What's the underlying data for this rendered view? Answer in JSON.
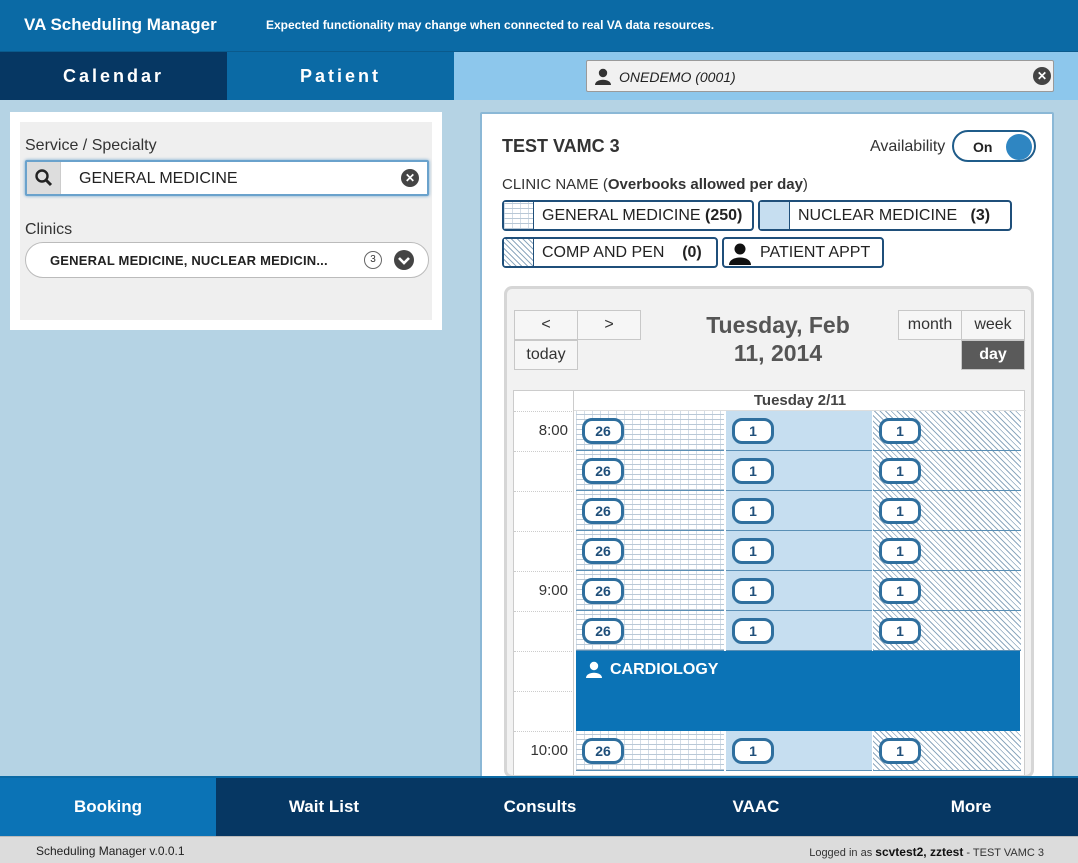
{
  "header": {
    "app_title": "VA Scheduling Manager",
    "notice": "Expected functionality may change when connected to real VA data resources."
  },
  "nav": {
    "tabs": [
      {
        "label": "Calendar",
        "active": true
      },
      {
        "label": "Patient",
        "active": false
      }
    ],
    "patient_selector": {
      "value": "ONEDEMO (0001)",
      "icon": "person-icon"
    }
  },
  "filters": {
    "service_label": "Service / Specialty",
    "service_value": "GENERAL MEDICINE",
    "clinics_label": "Clinics",
    "clinics_value": "GENERAL MEDICINE, NUCLEAR MEDICIN...",
    "clinics_count": "3"
  },
  "facility": {
    "name": "TEST VAMC 3",
    "availability_label": "Availability",
    "availability_state": "On",
    "clinic_header_prefix": "CLINIC NAME (",
    "clinic_header_bold": "Overbooks allowed per day",
    "clinic_header_suffix": ")"
  },
  "legend": [
    {
      "name": "GENERAL MEDICINE",
      "count": "(250)",
      "pattern": "brick"
    },
    {
      "name": "NUCLEAR MEDICINE",
      "count": "(3)",
      "pattern": "solid"
    },
    {
      "name": "COMP AND PEN",
      "count": "(0)",
      "pattern": "diagonal"
    },
    {
      "name": "PATIENT APPT",
      "count": "",
      "pattern": "person-icon"
    }
  ],
  "calendar": {
    "prev_label": "<",
    "next_label": ">",
    "today_label": "today",
    "title_line1": "Tuesday, Feb",
    "title_line2": "11, 2014",
    "views": [
      {
        "label": "month",
        "active": false
      },
      {
        "label": "week",
        "active": false
      },
      {
        "label": "day",
        "active": true
      }
    ],
    "day_header": "Tuesday 2/11",
    "times": [
      "8:00",
      "",
      "",
      "",
      "9:00",
      "",
      "",
      "",
      "10:00"
    ],
    "columns": [
      {
        "pattern": "brick",
        "slots": [
          "26",
          "26",
          "26",
          "26",
          "26",
          "26",
          "",
          "",
          "26"
        ]
      },
      {
        "pattern": "solid",
        "slots": [
          "1",
          "1",
          "1",
          "1",
          "1",
          "1",
          "",
          "",
          "1"
        ]
      },
      {
        "pattern": "diagonal",
        "slots": [
          "1",
          "1",
          "1",
          "1",
          "1",
          "1",
          "",
          "",
          "1"
        ]
      }
    ],
    "appointment": {
      "label": "CARDIOLOGY",
      "icon": "person-icon"
    }
  },
  "bottom_nav": [
    {
      "label": "Booking",
      "active": true
    },
    {
      "label": "Wait List",
      "active": false
    },
    {
      "label": "Consults",
      "active": false
    },
    {
      "label": "VAAC",
      "active": false
    },
    {
      "label": "More",
      "active": false
    }
  ],
  "footer": {
    "version": "Scheduling Manager v.0.0.1",
    "logged_in_prefix": "Logged in as ",
    "logged_in_user": "scvtest2, zztest",
    "logged_in_suffix": " - TEST VAMC 3"
  },
  "colors": {
    "header": "#0b6aa5",
    "nav_dark": "#063763",
    "appointment": "#0b73b6"
  }
}
